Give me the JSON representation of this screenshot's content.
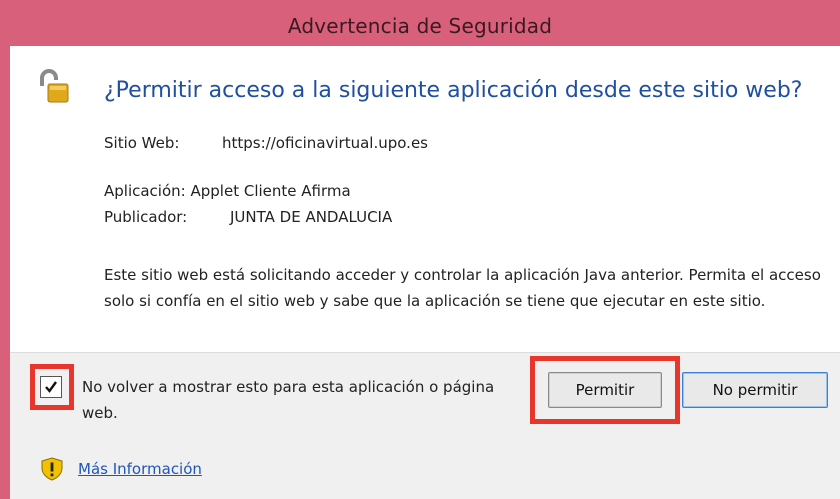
{
  "window": {
    "title": "Advertencia de Seguridad"
  },
  "dialog": {
    "heading": "¿Permitir acceso a la siguiente aplicación desde este sitio web?",
    "website_label": "Sitio Web:",
    "website_value": "https://oficinavirtual.upo.es",
    "application_label": "Aplicación:",
    "application_value": "Applet Cliente Afirma",
    "publisher_label": "Publicador:",
    "publisher_value": "JUNTA DE ANDALUCIA",
    "warning_text": "Este sitio web está solicitando acceder y controlar la aplicación Java anterior. Permita el acceso solo si confía en el sitio web y sabe que la aplicación se tiene que ejecutar en este sitio."
  },
  "footer": {
    "checkbox_checked": true,
    "checkbox_label": "No volver a mostrar esto para esta aplicación o página web.",
    "permit_label": "Permitir",
    "deny_label": "No permitir",
    "more_info_label": "Más Información"
  },
  "icons": {
    "lock": "unlocked-padlock-icon",
    "shield": "warning-shield-icon",
    "check": "checkmark-icon"
  },
  "colors": {
    "title_bar": "#d9607a",
    "heading": "#1f4fa0",
    "highlight": "#e8362c",
    "link": "#1f56b8"
  }
}
